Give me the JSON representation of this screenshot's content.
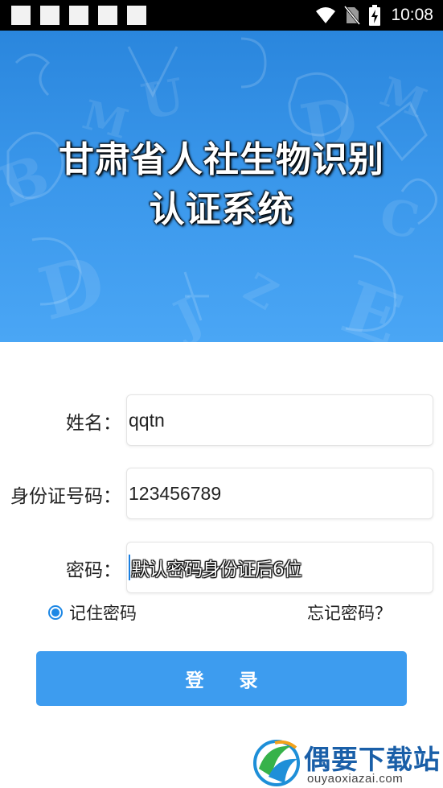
{
  "status_bar": {
    "time": "10:08",
    "notification_count": 5,
    "icons": [
      "wifi-icon",
      "no-sim-icon",
      "battery-charging-icon"
    ]
  },
  "header": {
    "title_line1": "甘肃省人社生物识别",
    "title_line2": "认证系统"
  },
  "form": {
    "name_label": "姓名：",
    "name_value": "qqtn",
    "id_label": "身份证号码：",
    "id_value": "123456789",
    "password_label": "密码：",
    "password_placeholder": "默认密码身份证后6位"
  },
  "options": {
    "remember_label": "记住密码",
    "remember_checked": true,
    "forgot_label": "忘记密码？"
  },
  "login_button": {
    "label": "登 录"
  },
  "watermark": {
    "title": "偶要下载站",
    "url": "ouyaoxiazai.com"
  },
  "colors": {
    "accent": "#3d9cef",
    "banner_top": "#2a86dd",
    "banner_bottom": "#4aa6f5",
    "watermark_text": "#1a5fa8"
  }
}
